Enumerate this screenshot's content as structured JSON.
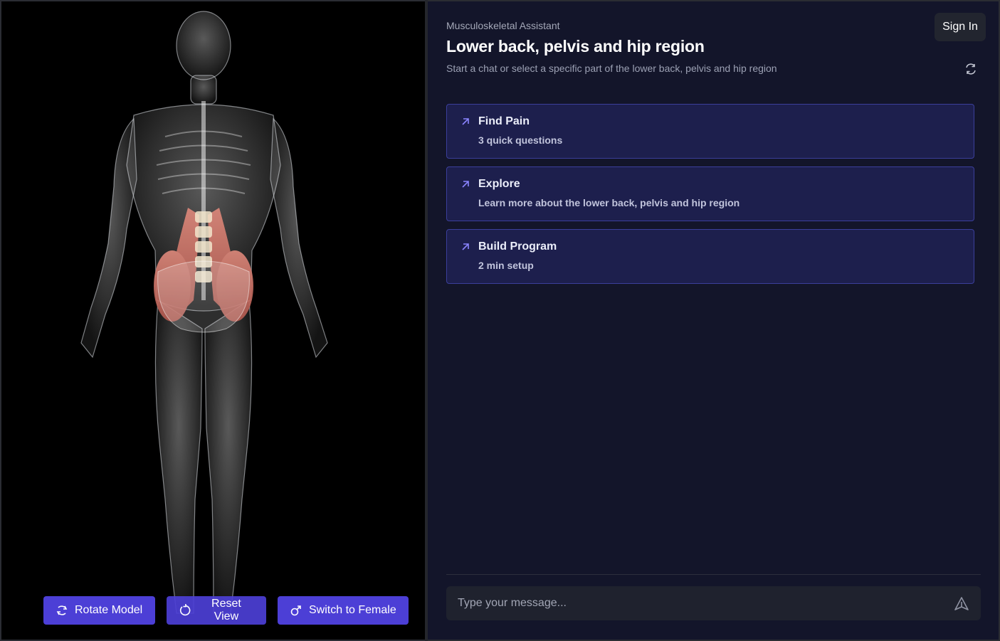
{
  "viewer": {
    "buttons": {
      "rotate": "Rotate Model",
      "reset": "Reset View",
      "switch": "Switch to Female"
    },
    "highlight_color": "#c9695f"
  },
  "header": {
    "app_name": "Musculoskeletal Assistant",
    "title": "Lower back, pelvis and hip region",
    "description": "Start a chat or select a specific part of the lower back, pelvis and hip region",
    "sign_in": "Sign In"
  },
  "cards": [
    {
      "title": "Find Pain",
      "subtitle": "3 quick questions",
      "icon": "arrow-up-left-icon"
    },
    {
      "title": "Explore",
      "subtitle": "Learn more about the lower back, pelvis and hip region",
      "icon": "arrow-up-left-icon"
    },
    {
      "title": "Build Program",
      "subtitle": "2 min setup",
      "icon": "arrow-up-left-icon"
    }
  ],
  "composer": {
    "placeholder": "Type your message..."
  },
  "colors": {
    "accent": "#4c3fd6",
    "panel_bg": "#13152a",
    "card_bg": "#1d1f4d",
    "card_border": "#3b3f9b"
  }
}
